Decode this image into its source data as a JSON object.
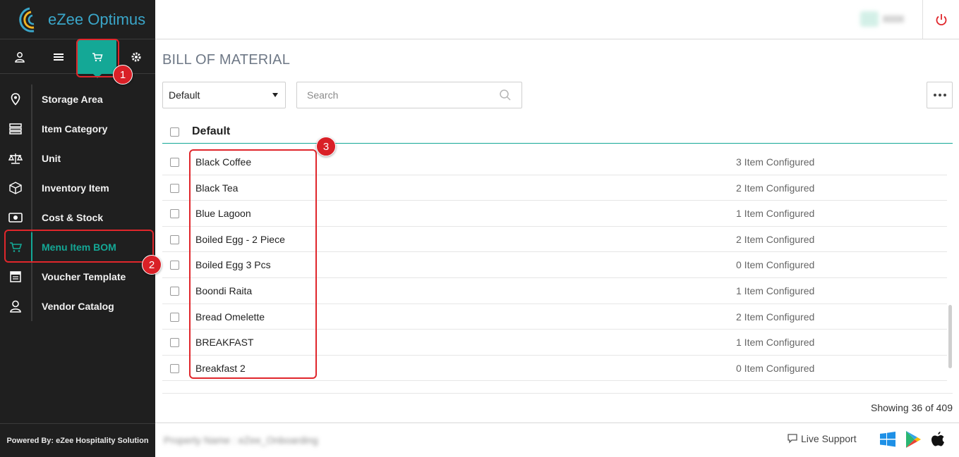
{
  "brand": {
    "name": "eZee Optimus"
  },
  "top_tabs": [
    {
      "icon": "user-icon"
    },
    {
      "icon": "list-icon"
    },
    {
      "icon": "cart-icon",
      "active": true
    },
    {
      "icon": "gear-icon"
    }
  ],
  "sidebar": {
    "items": [
      {
        "label": "Storage Area",
        "icon": "map-pin-icon"
      },
      {
        "label": "Item Category",
        "icon": "category-icon"
      },
      {
        "label": "Unit",
        "icon": "scale-icon"
      },
      {
        "label": "Inventory Item",
        "icon": "box-icon"
      },
      {
        "label": "Cost & Stock",
        "icon": "money-icon"
      },
      {
        "label": "Menu Item BOM",
        "icon": "cart-icon",
        "active": true
      },
      {
        "label": "Voucher Template",
        "icon": "voucher-icon"
      },
      {
        "label": "Vendor Catalog",
        "icon": "vendor-icon"
      }
    ],
    "footer": "Powered By: eZee Hospitality Solution"
  },
  "page": {
    "title": "BILL OF MATERIAL",
    "filter_value": "Default",
    "search_placeholder": "Search",
    "group_title": "Default",
    "showing": "Showing 36 of 409"
  },
  "rows": [
    {
      "name": "Black Coffee",
      "status": "3 Item Configured"
    },
    {
      "name": "Black Tea",
      "status": "2 Item Configured"
    },
    {
      "name": "Blue Lagoon",
      "status": "1 Item Configured"
    },
    {
      "name": "Boiled Egg - 2 Piece",
      "status": "2 Item Configured"
    },
    {
      "name": "Boiled Egg 3 Pcs",
      "status": "0 Item Configured"
    },
    {
      "name": "Boondi Raita",
      "status": "1 Item Configured"
    },
    {
      "name": "Bread Omelette",
      "status": "2 Item Configured"
    },
    {
      "name": "BREAKFAST",
      "status": "1 Item Configured"
    },
    {
      "name": "Breakfast 2",
      "status": "0 Item Configured"
    }
  ],
  "footer": {
    "property_blurred": "Property Name : eZee_Onboarding",
    "live_support": "Live Support"
  },
  "annotations": [
    "1",
    "2",
    "3"
  ],
  "colors": {
    "accent": "#14a896",
    "sidebar_bg": "#1f1f1f",
    "annotation": "#e0262b"
  }
}
